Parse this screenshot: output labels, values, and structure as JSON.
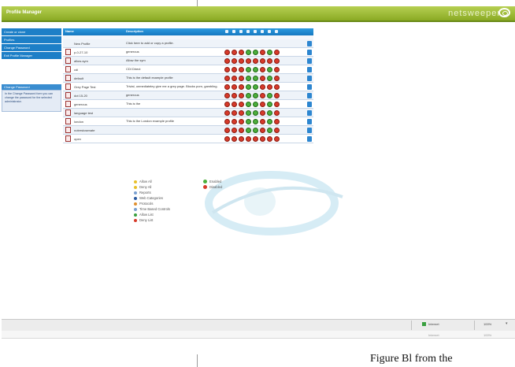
{
  "app": {
    "title": "Profile Manager",
    "brand": "netsweeper"
  },
  "sidebar": {
    "items": [
      {
        "label": "Create or clone"
      },
      {
        "label": "Profiles"
      },
      {
        "label": "Change Password"
      },
      {
        "label": "Exit Profile Manager"
      }
    ],
    "note_title": "Change Password",
    "note_text": "In the Change Password form you can change the password for the selected administrator."
  },
  "table": {
    "headers": {
      "name": "Name",
      "description": "Description"
    },
    "rows": [
      {
        "name": "New Profile",
        "description": "Click here to add or copy a profile.",
        "icon": false,
        "dots": ""
      },
      {
        "name": "p-0-27-10",
        "description": "generous",
        "icon": true,
        "dots": "rrrggrgr"
      },
      {
        "name": "allow-sym",
        "description": "Allow the sym",
        "icon": true,
        "dots": "rrrrrrrr"
      },
      {
        "name": "cdi",
        "description": "CDI Direct",
        "icon": true,
        "dots": "rrrggrgr"
      },
      {
        "name": "default",
        "description": "This is the default example profile",
        "icon": true,
        "dots": "rrrggrgr"
      },
      {
        "name": "Grey Page Test",
        "description": "Trivial, unmediateley give me a grey page. Blocks porn, gambling.",
        "icon": true,
        "dots": "rrrggrrr"
      },
      {
        "name": "dot 15-20",
        "description": "generous",
        "icon": true,
        "dots": "rrrggrgr"
      },
      {
        "name": "generous",
        "description": "This is the",
        "icon": true,
        "dots": "rrrggrgr"
      },
      {
        "name": "language test",
        "description": "",
        "icon": true,
        "dots": "rrrggrgr"
      },
      {
        "name": "london",
        "description": "This is the London example profile",
        "icon": true,
        "dots": "rrrggrgr"
      },
      {
        "name": "notrestosenate",
        "description": "",
        "icon": true,
        "dots": "rrrggrgr"
      },
      {
        "name": "open",
        "description": "",
        "icon": true,
        "dots": "rrrrrrrr"
      }
    ]
  },
  "legend": {
    "items": [
      {
        "label": "Allow All",
        "color": "#e8c02a"
      },
      {
        "label": "Deny All",
        "color": "#e8c02a"
      },
      {
        "label": "Reports",
        "color": "#7aa0d0"
      },
      {
        "label": "Web Categories",
        "color": "#2a5aa0"
      },
      {
        "label": "Protocols",
        "color": "#e09030"
      },
      {
        "label": "Time Based Controls",
        "color": "#7aa0d0"
      },
      {
        "label": "Allow List",
        "color": "#3aa040"
      },
      {
        "label": "Deny List",
        "color": "#d73a2a"
      }
    ],
    "states": [
      {
        "label": "Enabled",
        "color": "#4caf3c"
      },
      {
        "label": "Disabled",
        "color": "#d73a2a"
      }
    ]
  },
  "statusbar": {
    "zone": "Internet",
    "zoom": "100%",
    "zone_sub": "Internet",
    "zoom_sub": "100%"
  },
  "caption": "Figure Bl from the"
}
